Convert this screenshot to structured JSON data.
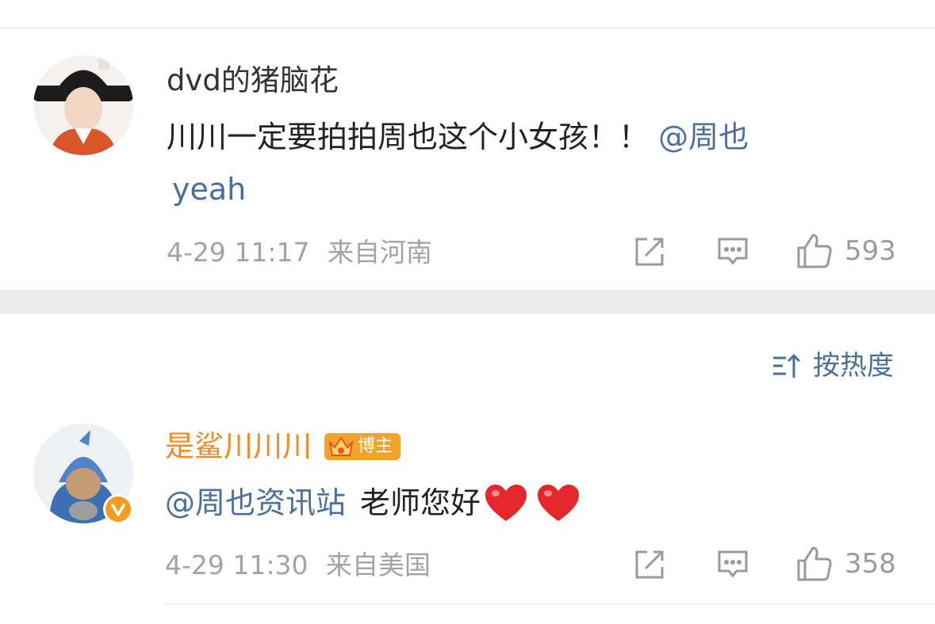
{
  "comment_1": {
    "username": "dvd的猪脑花",
    "text": "川川一定要拍拍周也这个小女孩！！",
    "mention": "@周也",
    "text_line2": "yeah",
    "timestamp": "4-29 11:17",
    "location": "来自河南",
    "likes": "593"
  },
  "sort": {
    "label": "按热度"
  },
  "comment_2": {
    "username": "是鲨川川川",
    "badge": "博主",
    "mention": "@周也资讯站",
    "text": "老师您好",
    "timestamp": "4-29 11:30",
    "location": "来自美国",
    "likes": "358"
  },
  "colors": {
    "link": "#4a6f9b",
    "author_name": "#f08a24",
    "badge": "#f3a22b",
    "verified": "#f39c1f",
    "heart": "#e6262d"
  },
  "icons": [
    "share-icon",
    "comment-icon",
    "like-icon",
    "sort-icon",
    "crown-icon",
    "heart-icon",
    "verified-icon"
  ]
}
